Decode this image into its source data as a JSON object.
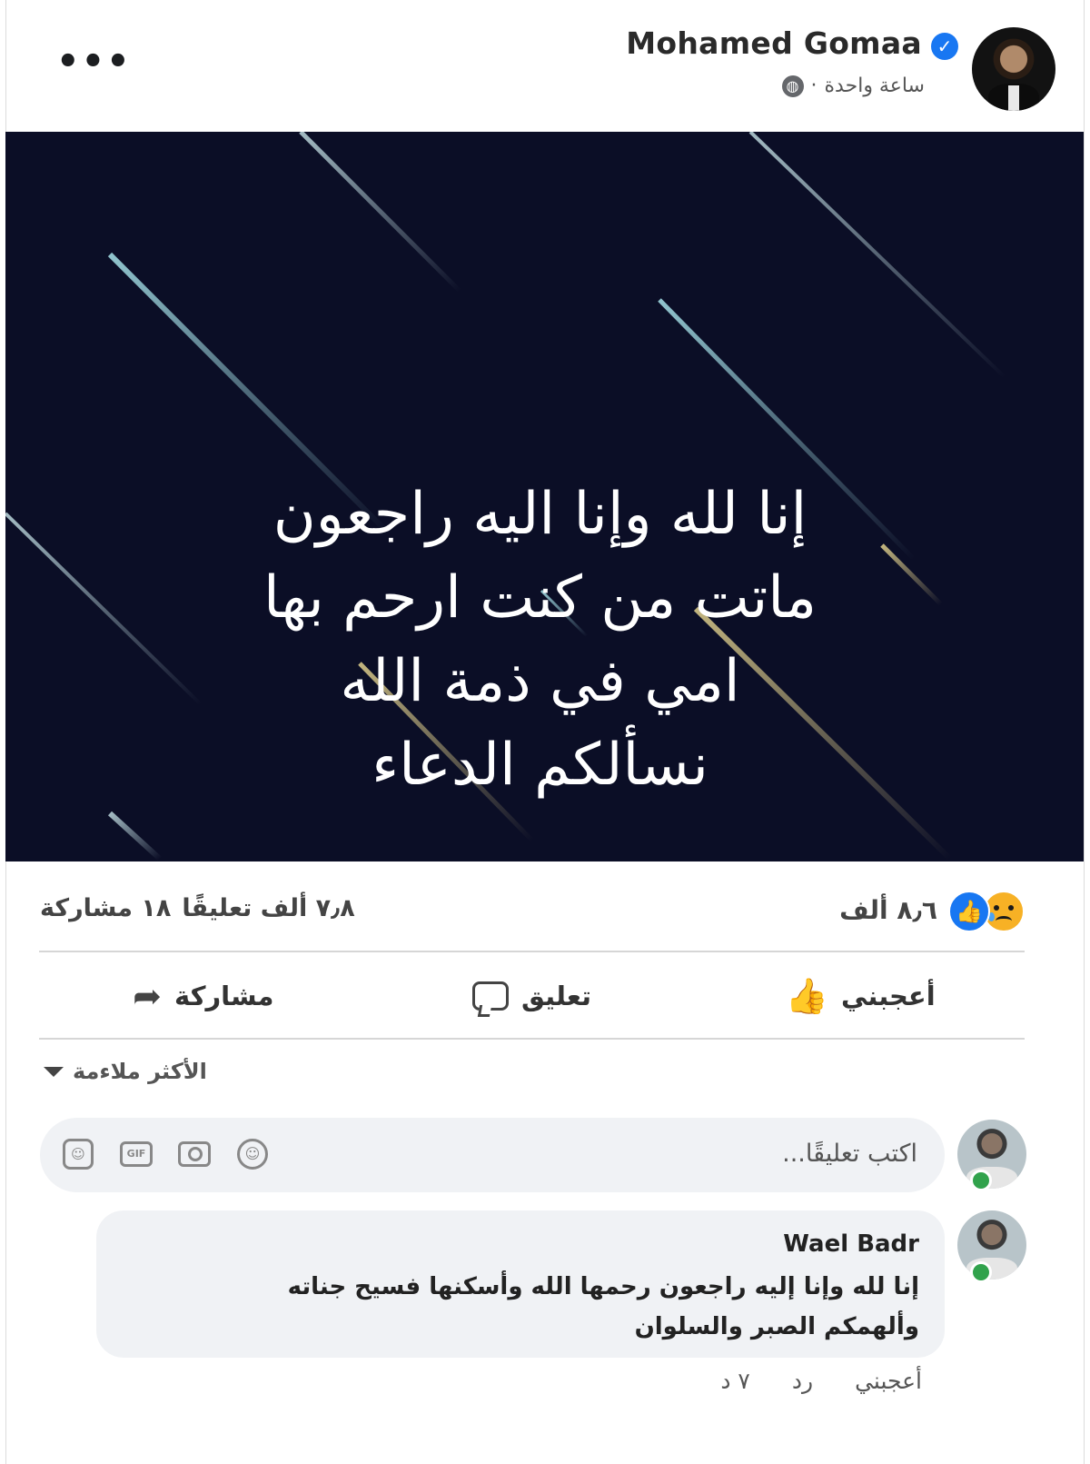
{
  "post": {
    "author": "Mohamed Gomaa",
    "verified_mark": "✓",
    "time": "ساعة واحدة",
    "separator": "·",
    "privacy_icon": "globe-icon",
    "more_label": "•••",
    "image_lines": [
      "إنا لله وإنا اليه راجعون",
      "ماتت من كنت ارحم بها",
      "امي في ذمة الله",
      "نسألكم الدعاء"
    ]
  },
  "summary": {
    "reaction_count": "٨٫٦ ألف",
    "reaction_icons": [
      "sad-icon",
      "like-icon"
    ],
    "comments": "٧٫٨ ألف تعليقًا",
    "shares": "١٨ مشاركة"
  },
  "actions": {
    "like": "أعجبني",
    "comment": "تعليق",
    "share": "مشاركة"
  },
  "sort": {
    "label": "الأكثر ملاءمة"
  },
  "composer": {
    "placeholder": "اكتب تعليقًا...",
    "tools": [
      "emoji-icon",
      "camera-icon",
      "gif-icon",
      "sticker-icon"
    ],
    "gif_label": "GIF"
  },
  "comments": [
    {
      "author": "Wael Badr",
      "text": "إنا لله وإنا إليه راجعون رحمها الله وأسكنها فسيح جناته وألهمكم الصبر والسلوان",
      "like_label": "أعجبني",
      "reply_label": "رد",
      "age": "٧ د"
    }
  ],
  "colors": {
    "image_background": "#0b0e26",
    "brand_blue": "#1877f2",
    "online_green": "#31a24c",
    "bubble_gray": "#f0f2f5"
  }
}
